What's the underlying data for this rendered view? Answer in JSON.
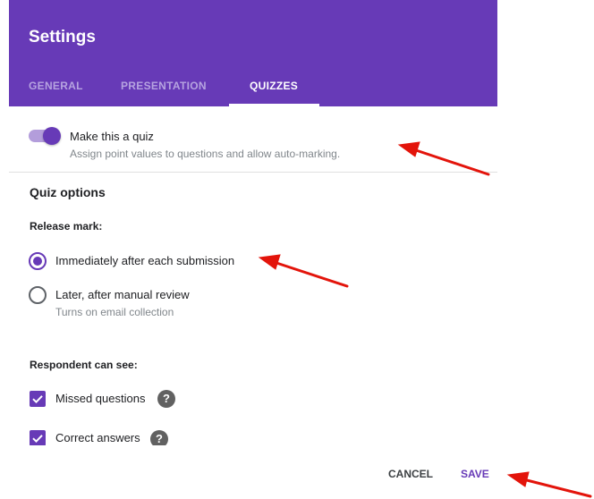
{
  "header": {
    "title": "Settings",
    "tabs": [
      {
        "label": "GENERAL"
      },
      {
        "label": "PRESENTATION"
      },
      {
        "label": "QUIZZES"
      }
    ],
    "active_tab": "QUIZZES",
    "color": "#673ab7"
  },
  "quiz_toggle": {
    "label": "Make this a quiz",
    "description": "Assign point values to questions and allow auto-marking.",
    "enabled": true
  },
  "quiz_options": {
    "title": "Quiz options",
    "release_mark": {
      "label": "Release mark:",
      "options": [
        {
          "label": "Immediately after each submission",
          "checked": true
        },
        {
          "label": "Later, after manual review",
          "description": "Turns on email collection",
          "checked": false
        }
      ]
    },
    "respondent": {
      "label": "Respondent can see:",
      "items": [
        {
          "label": "Missed questions",
          "checked": true,
          "icon": "help-icon"
        },
        {
          "label": "Correct answers",
          "checked": true,
          "icon": "help-icon"
        }
      ]
    }
  },
  "footer": {
    "cancel_label": "CANCEL",
    "save_label": "SAVE",
    "save_color": "#673ab7"
  },
  "annotations": {
    "arrow_color": "#e3140b",
    "count": 3
  }
}
